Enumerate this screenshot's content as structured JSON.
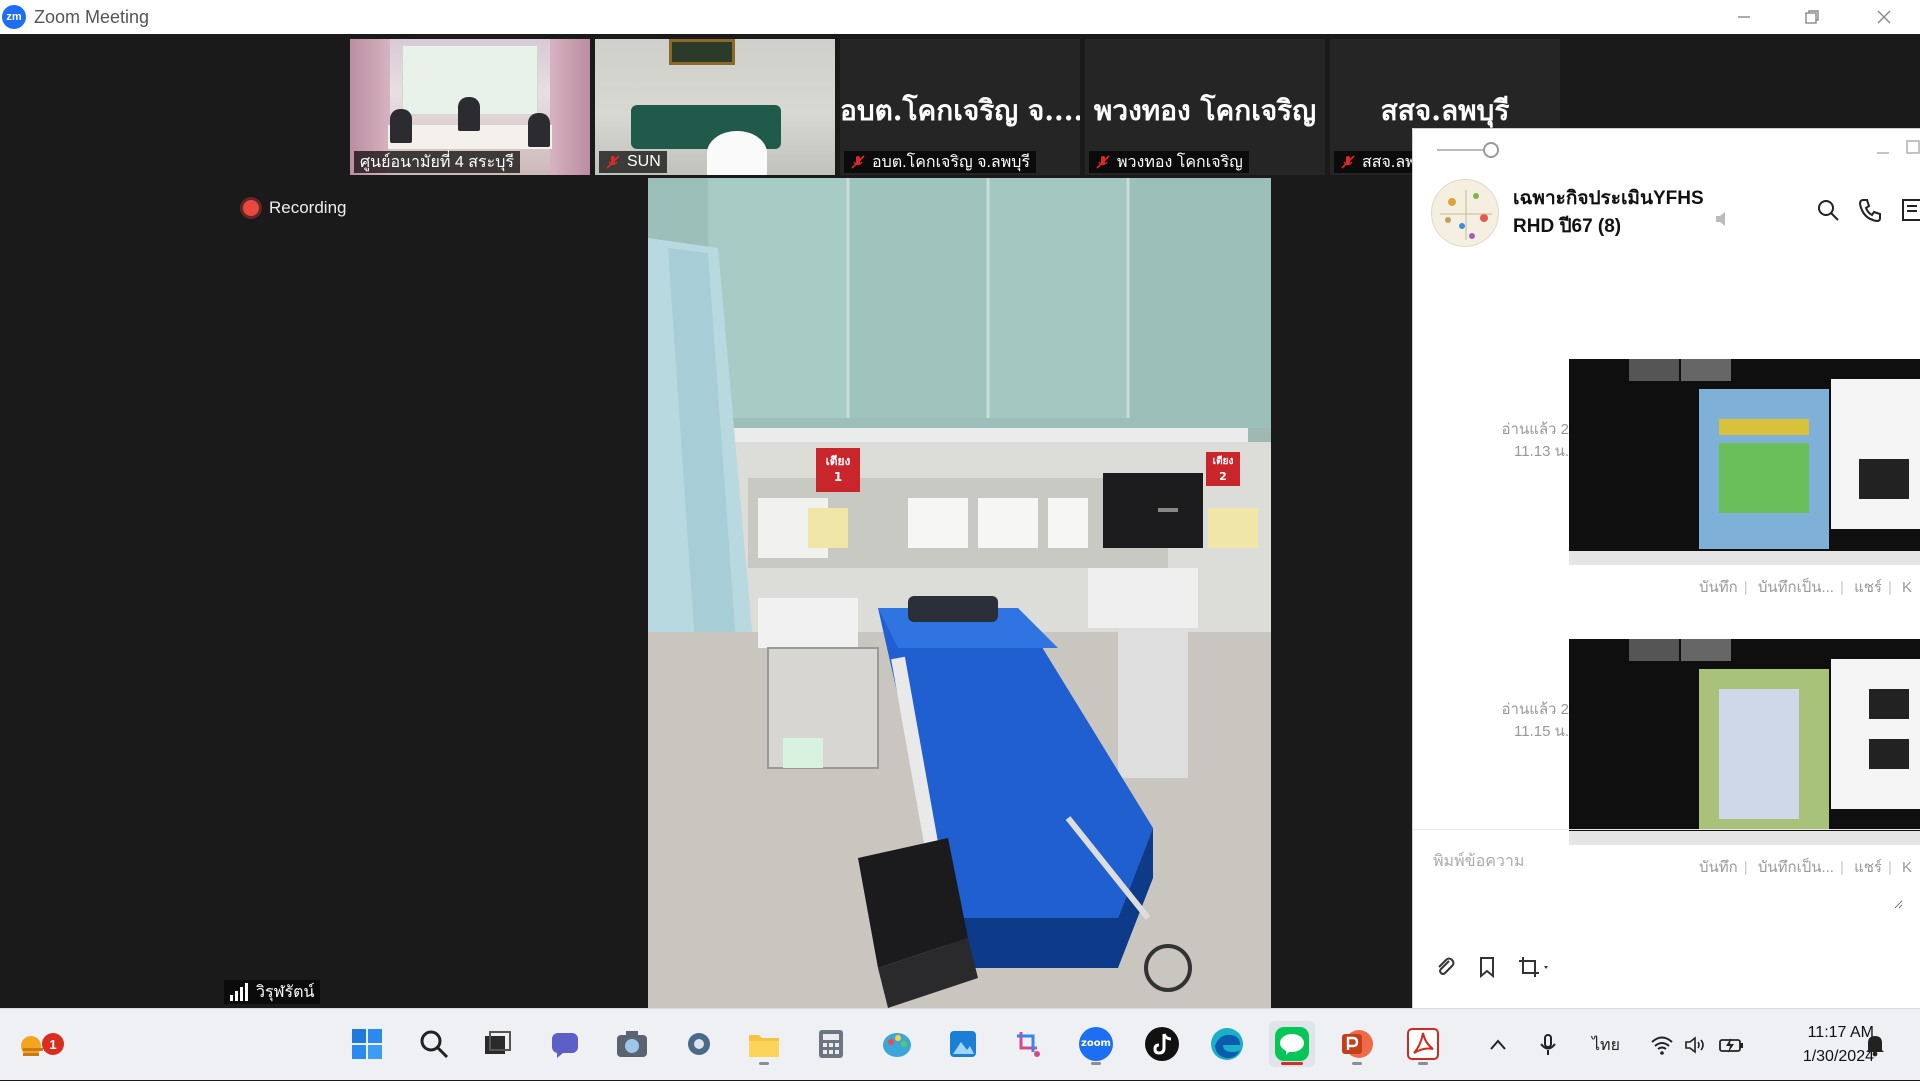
{
  "window": {
    "logo_text": "zm",
    "title": "Zoom Meeting"
  },
  "thumbnails": [
    {
      "name": "ศูนย์อนามัยที่ 4 สระบุรี",
      "muted": false,
      "has_video": true
    },
    {
      "name": "SUN",
      "muted": true,
      "has_video": true
    },
    {
      "name": "อบต.โคกเจริญ จ.ลพบุรี",
      "display_name": "อบต.โคกเจริญ จ....",
      "muted": true,
      "has_video": false
    },
    {
      "name": "พวงทอง โคกเจริญ",
      "display_name": "พวงทอง โคกเจริญ",
      "muted": true,
      "has_video": false
    },
    {
      "name": "สสจ.ลพ",
      "display_name": "สสจ.ลพบุรี",
      "muted": true,
      "has_video": false
    }
  ],
  "recording": {
    "label": "Recording"
  },
  "main_video": {
    "bed_label_1": "เตียง",
    "bed_number_1": "1",
    "bed_label_2": "เตียง",
    "bed_number_2": "2"
  },
  "speaker": {
    "name": "วิรุฬรัตน์"
  },
  "chat": {
    "group_name": "เฉพาะกิจประเมินYFHS RHD ปี67 (8)",
    "messages": [
      {
        "read": "อ่านแล้ว 2",
        "time": "11.13 น.",
        "actions": [
          "บันทึก",
          "บันทึกเป็น...",
          "แชร์",
          "K"
        ]
      },
      {
        "read": "อ่านแล้ว 2",
        "time": "11.15 น.",
        "actions": [
          "บันทึก",
          "บันทึกเป็น...",
          "แชร์",
          "K"
        ]
      }
    ],
    "input_placeholder": "พิมพ์ข้อความ"
  },
  "taskbar": {
    "weather_badge": "1",
    "language": "ไทย",
    "time": "11:17 AM",
    "date": "1/30/2024",
    "zoom_label": "zoom"
  },
  "colors": {
    "zoom_blue": "#1d6ef2",
    "recording_red": "#e8483e",
    "line_green": "#06c755",
    "muted_red": "#e02828"
  }
}
